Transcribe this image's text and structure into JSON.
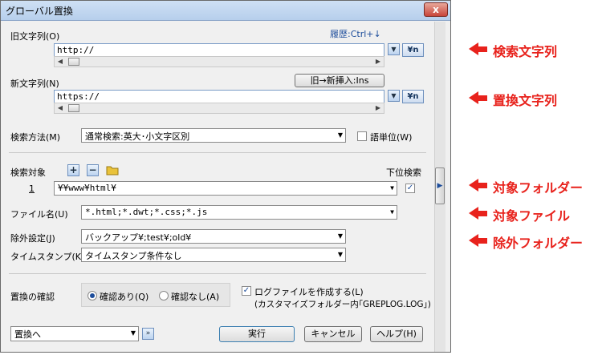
{
  "window": {
    "title": "グローバル置換",
    "close_label": "x"
  },
  "search": {
    "label": "旧文字列(O)",
    "history_label": "履歴:Ctrl+↓",
    "value": "http://",
    "regex_label": "¥n"
  },
  "replace": {
    "label": "新文字列(N)",
    "insert_button": "旧→新挿入:Ins",
    "value": "https://",
    "regex_label": "¥n"
  },
  "method": {
    "label": "検索方法(M)",
    "selected": "通常検索:英大･小文字区別",
    "word_unit_label": "語単位(W)",
    "word_unit_checked": false
  },
  "target": {
    "label": "検索対象",
    "subfolder_label": "下位検索",
    "row_number": "1",
    "folder_value": "¥¥www¥html¥",
    "subfolder_checked": true
  },
  "filename": {
    "label": "ファイル名(U)",
    "value": "*.html;*.dwt;*.css;*.js"
  },
  "exclude": {
    "label": "除外設定(J)",
    "value": "バックアップ¥;test¥;old¥"
  },
  "timestamp": {
    "label": "タイムスタンプ(K)",
    "value": "タイムスタンプ条件なし"
  },
  "confirm": {
    "label": "置換の確認",
    "option_yes": "確認あり(Q)",
    "option_no": "確認なし(A)",
    "selected": "yes",
    "log_label": "ログファイルを作成する(L)",
    "log_checked": true,
    "log_note": "(カスタマイズフォルダー内｢GREPLOG.LOG｣)"
  },
  "footer": {
    "action_select": "置換へ",
    "run_button": "実行",
    "cancel_button": "キャンセル",
    "help_button": "ヘルプ(H)"
  },
  "annotations": {
    "search_string": "検索文字列",
    "replace_string": "置換文字列",
    "target_folder": "対象フォルダー",
    "target_file": "対象ファイル",
    "exclude_folder": "除外フォルダー"
  },
  "colors": {
    "annotation": "#e8221c",
    "link": "#1d4d9b"
  }
}
